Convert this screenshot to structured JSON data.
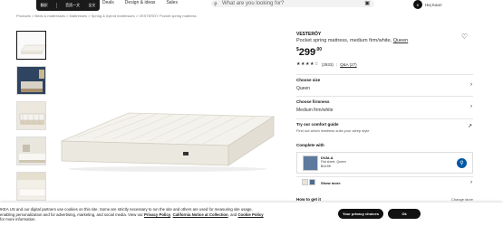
{
  "toolbar": {
    "items": [
      "翻訳",
      "音読ー文",
      "全文"
    ]
  },
  "nav": {
    "items": [
      "Deals",
      "Design & ideas",
      "Sales"
    ]
  },
  "search": {
    "placeholder": "What are you looking for?"
  },
  "user": {
    "initial": "K",
    "greeting": "Hej Kaori"
  },
  "breadcrumb": "Products  >  Beds & mattresses  >  Mattresses  >  Spring & hybrid mattresses  >  VESTERÖY Pocket spring mattress",
  "product": {
    "name": "VESTERÖY",
    "description": "Pocket spring mattress, medium firm/white,",
    "size_link": "Queen",
    "price_currency": "$",
    "price_whole": "299",
    "price_cents": ".00",
    "stars": "★★★★☆",
    "review_count": "(2933)",
    "qa": "Q&A (27)"
  },
  "options": {
    "size_label": "Choose size",
    "size_value": "Queen",
    "firmness_label": "Choose firmness",
    "firmness_value": "Medium firm/white",
    "guide_label": "Try our comfort guide",
    "guide_sub": "Find out which mattress suits your sleep style"
  },
  "complete": {
    "title": "Complete with",
    "item_name": "DVALA",
    "item_desc": "Flat sheet, Queen",
    "item_price": "$14.99",
    "more_label": "Show more"
  },
  "how": {
    "title": "How to get it",
    "change": "Change store"
  },
  "cookie": {
    "text1": "IKEA US and our digital partners use cookies on this site. Some are strictly necessary to run the site and others are used for measuring site usage,",
    "text2": "enabling personalization and for advertising, marketing, and social media. View our",
    "link1": "Privacy Policy",
    "link2": "California Notice at Collection",
    "and": ", and",
    "link3": "Cookie Policy",
    "text3": "for more information.",
    "privacy_button": "Your privacy choices",
    "ok_button": "Ok"
  }
}
